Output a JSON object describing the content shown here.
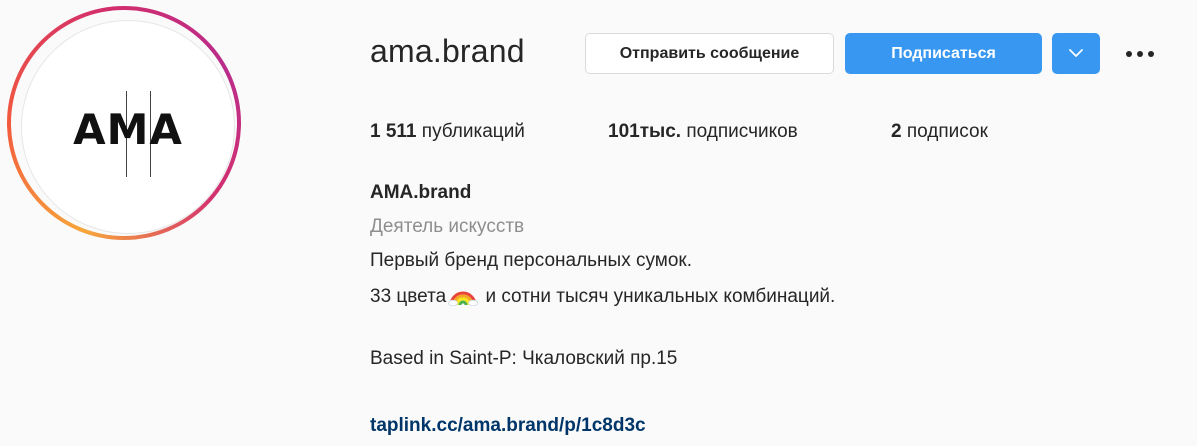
{
  "profile": {
    "avatar_logo_text": "AMA",
    "username": "ama.brand",
    "message_button_label": "Отправить сообщение",
    "follow_button_label": "Подписаться"
  },
  "stats": {
    "posts_count": "1 511",
    "posts_label": "публикаций",
    "followers_count": "101тыс.",
    "followers_label": "подписчиков",
    "following_count": "2",
    "following_label": "подписок"
  },
  "bio": {
    "full_name": "AMA.brand",
    "category": "Деятель искусств",
    "line1": "Первый бренд персональных сумок.",
    "line2_before_emoji": "33 цвета",
    "line2_emoji": "rainbow-emoji",
    "line2_after_emoji": " и сотни тысяч уникальных комбинаций.",
    "line3": "Based in Saint-P: Чкаловский пр.15",
    "link": "taplink.cc/ama.brand/p/1c8d3c"
  },
  "colors": {
    "accent_blue": "#3897f0",
    "link_color": "#003569",
    "muted_text": "#8e8e8e",
    "text": "#262626"
  },
  "icons": {
    "dropdown": "chevron-down-icon",
    "more": "more-horizontal-icon"
  }
}
